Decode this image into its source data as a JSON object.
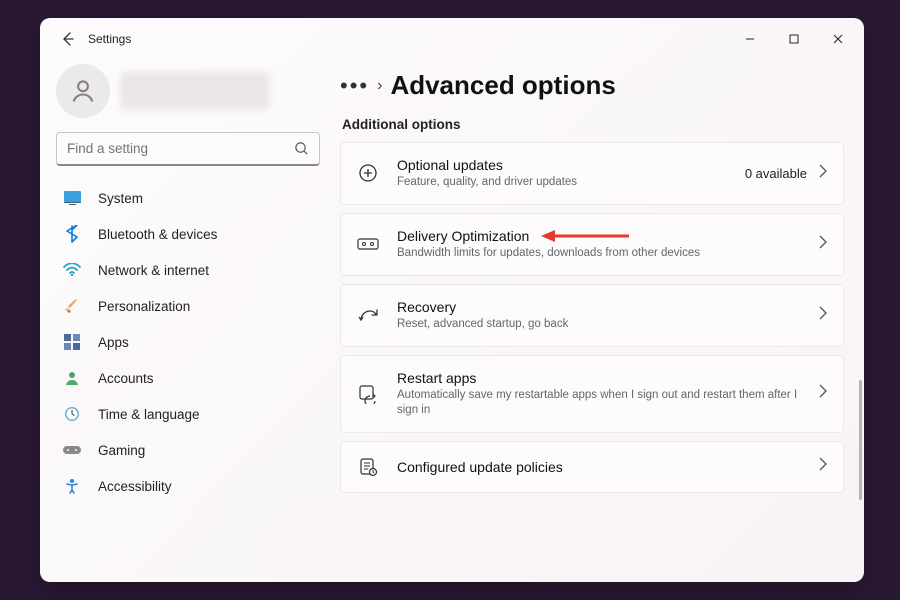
{
  "titlebar": {
    "title": "Settings"
  },
  "search": {
    "placeholder": "Find a setting"
  },
  "sidebar": {
    "items": [
      {
        "label": "System",
        "icon": "monitor"
      },
      {
        "label": "Bluetooth & devices",
        "icon": "bluetooth"
      },
      {
        "label": "Network & internet",
        "icon": "wifi"
      },
      {
        "label": "Personalization",
        "icon": "brush"
      },
      {
        "label": "Apps",
        "icon": "apps"
      },
      {
        "label": "Accounts",
        "icon": "person"
      },
      {
        "label": "Time & language",
        "icon": "clock"
      },
      {
        "label": "Gaming",
        "icon": "gamepad"
      },
      {
        "label": "Accessibility",
        "icon": "accessibility"
      }
    ]
  },
  "breadcrumb": {
    "page_title": "Advanced options"
  },
  "section": {
    "header": "Additional options"
  },
  "cards": [
    {
      "title": "Optional updates",
      "sub": "Feature, quality, and driver updates",
      "extra": "0 available",
      "icon": "plus-circle"
    },
    {
      "title": "Delivery Optimization",
      "sub": "Bandwidth limits for updates, downloads from other devices",
      "extra": "",
      "icon": "delivery"
    },
    {
      "title": "Recovery",
      "sub": "Reset, advanced startup, go back",
      "extra": "",
      "icon": "recovery"
    },
    {
      "title": "Restart apps",
      "sub": "Automatically save my restartable apps when I sign out and restart them after I sign in",
      "extra": "",
      "icon": "restart-apps"
    },
    {
      "title": "Configured update policies",
      "sub": "",
      "extra": "",
      "icon": "policy"
    }
  ],
  "colors": {
    "annotation": "#e53a2e"
  }
}
